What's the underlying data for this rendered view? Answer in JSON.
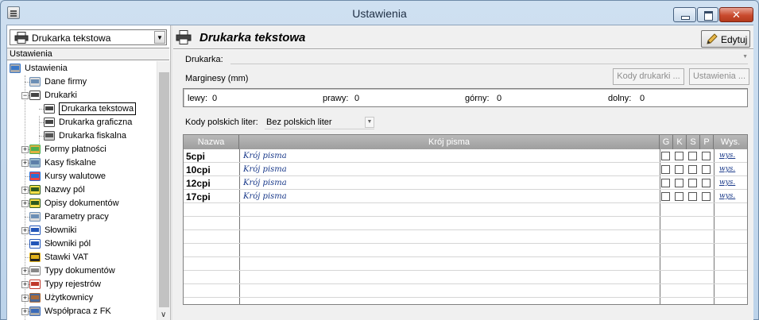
{
  "window": {
    "title": "Ustawienia",
    "close_glyph": "✕"
  },
  "left": {
    "combo_value": "Drukarka tekstowa",
    "tree_header": "Ustawienia",
    "tree": [
      {
        "label": "Ustawienia",
        "icon": "settings-tools-icon",
        "level": 0,
        "expander": "",
        "selected": false
      },
      {
        "label": "Dane firmy",
        "icon": "company-icon",
        "level": 1,
        "expander": "",
        "selected": false
      },
      {
        "label": "Drukarki",
        "icon": "printer-icon",
        "level": 1,
        "expander": "−",
        "selected": false
      },
      {
        "label": "Drukarka tekstowa",
        "icon": "printer-icon",
        "level": 2,
        "expander": "",
        "selected": true
      },
      {
        "label": "Drukarka graficzna",
        "icon": "printer-icon",
        "level": 2,
        "expander": "",
        "selected": false
      },
      {
        "label": "Drukarka fiskalna",
        "icon": "fiscal-printer-icon",
        "level": 2,
        "expander": "",
        "selected": false
      },
      {
        "label": "Formy płatności",
        "icon": "payment-icon",
        "level": 1,
        "expander": "+",
        "selected": false
      },
      {
        "label": "Kasy fiskalne",
        "icon": "cash-register-icon",
        "level": 1,
        "expander": "+",
        "selected": false
      },
      {
        "label": "Kursy walutowe",
        "icon": "exchange-chart-icon",
        "level": 1,
        "expander": "",
        "selected": false
      },
      {
        "label": "Nazwy pól",
        "icon": "az-icon",
        "level": 1,
        "expander": "+",
        "selected": false
      },
      {
        "label": "Opisy dokumentów",
        "icon": "az-icon",
        "level": 1,
        "expander": "+",
        "selected": false
      },
      {
        "label": "Parametry pracy",
        "icon": "company-icon",
        "level": 1,
        "expander": "",
        "selected": false
      },
      {
        "label": "Słowniki",
        "icon": "az-blue-icon",
        "level": 1,
        "expander": "+",
        "selected": false
      },
      {
        "label": "Słowniki pól",
        "icon": "az-blue-icon",
        "level": 1,
        "expander": "",
        "selected": false
      },
      {
        "label": "Stawki VAT",
        "icon": "vat-icon",
        "level": 1,
        "expander": "",
        "selected": false
      },
      {
        "label": "Typy dokumentów",
        "icon": "documents-icon",
        "level": 1,
        "expander": "+",
        "selected": false
      },
      {
        "label": "Typy rejestrów",
        "icon": "register-icon",
        "level": 1,
        "expander": "+",
        "selected": false
      },
      {
        "label": "Użytkownicy",
        "icon": "users-icon",
        "level": 1,
        "expander": "+",
        "selected": false
      },
      {
        "label": "Współpraca z FK",
        "icon": "fk-icon",
        "level": 1,
        "expander": "+",
        "selected": false
      }
    ]
  },
  "right": {
    "title": "Drukarka tekstowa",
    "edit_label": "Edytuj",
    "printer_label": "Drukarka:",
    "printer_value": "",
    "margins_label": "Marginesy (mm)",
    "btn_codes": "Kody drukarki ...",
    "btn_settings": "Ustawienia ...",
    "margins": {
      "left_label": "lewy:",
      "left_value": "0",
      "right_label": "prawy:",
      "right_value": "0",
      "top_label": "górny:",
      "top_value": "0",
      "bottom_label": "dolny:",
      "bottom_value": "0"
    },
    "polish_label": "Kody polskich liter:",
    "polish_value": "Bez polskich liter",
    "grid": {
      "columns": [
        "Nazwa",
        "Krój pisma",
        "G",
        "K",
        "S",
        "P",
        "Wys."
      ],
      "rows": [
        {
          "name": "5cpi",
          "font": "Krój pisma",
          "wys": "wys."
        },
        {
          "name": "10cpi",
          "font": "Krój pisma",
          "wys": "wys."
        },
        {
          "name": "12cpi",
          "font": "Krój pisma",
          "wys": "wys."
        },
        {
          "name": "17cpi",
          "font": "Krój pisma",
          "wys": "wys."
        }
      ]
    }
  }
}
